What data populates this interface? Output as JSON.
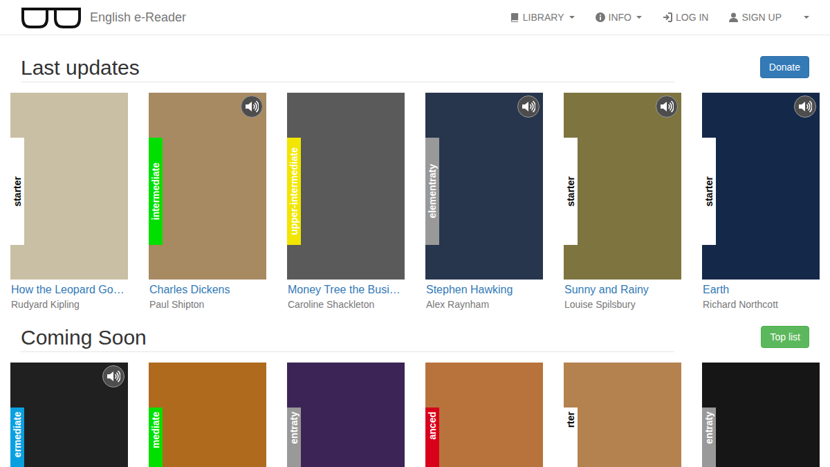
{
  "brand": {
    "title": "English e-Reader"
  },
  "nav": [
    {
      "label": "LIBRARY",
      "kind": "book",
      "dropdown": true
    },
    {
      "label": "INFO",
      "kind": "info",
      "dropdown": true
    },
    {
      "label": "LOG IN",
      "kind": "login",
      "dropdown": false
    },
    {
      "label": "SIGN UP",
      "kind": "user",
      "dropdown": false
    },
    {
      "label": "",
      "kind": "none",
      "dropdown": true
    }
  ],
  "sections": [
    {
      "title": "Last updates",
      "button": {
        "label": "Donate",
        "kind": "primary"
      },
      "books": [
        {
          "title": "How the Leopard Go…",
          "author": "Rudyard Kipling",
          "level": {
            "label": "starter",
            "color": "#ffffff"
          },
          "audio": false,
          "color": "#c9bfa5"
        },
        {
          "title": "Charles Dickens",
          "author": "Paul Shipton",
          "level": {
            "label": "intermediate",
            "color": "#00e000"
          },
          "audio": true,
          "color": "#a88a62"
        },
        {
          "title": "Money Tree the Busi…",
          "author": "Caroline Shackleton",
          "level": {
            "label": "upper-intermediate",
            "color": "#f2e600"
          },
          "audio": false,
          "color": "#5a5a5a"
        },
        {
          "title": "Stephen Hawking",
          "author": "Alex Raynham",
          "level": {
            "label": "elementraty",
            "color": "#999999"
          },
          "audio": true,
          "color": "#27354d"
        },
        {
          "title": "Sunny and Rainy",
          "author": "Louise Spilsbury",
          "level": {
            "label": "starter",
            "color": "#ffffff"
          },
          "audio": true,
          "color": "#7d7440"
        },
        {
          "title": "Earth",
          "author": "Richard Northcott",
          "level": {
            "label": "starter",
            "color": "#ffffff"
          },
          "audio": true,
          "color": "#14284a"
        }
      ]
    },
    {
      "title": "Coming Soon",
      "button": {
        "label": "Top list",
        "kind": "success"
      },
      "books": [
        {
          "level": {
            "label": "ermediate",
            "color": "#0aa0e0"
          },
          "audio": true,
          "color": "#202020"
        },
        {
          "level": {
            "label": "mediate",
            "color": "#00e000"
          },
          "audio": false,
          "color": "#b06a1e"
        },
        {
          "level": {
            "label": "entraty",
            "color": "#999999"
          },
          "audio": false,
          "color": "#3c2456"
        },
        {
          "level": {
            "label": "anced",
            "color": "#d9001b"
          },
          "audio": false,
          "color": "#b8733c"
        },
        {
          "level": {
            "label": "rter",
            "color": "#ffffff"
          },
          "audio": false,
          "color": "#b4824e"
        },
        {
          "level": {
            "label": "entraty",
            "color": "#999999"
          },
          "audio": false,
          "color": "#161616"
        }
      ]
    }
  ]
}
